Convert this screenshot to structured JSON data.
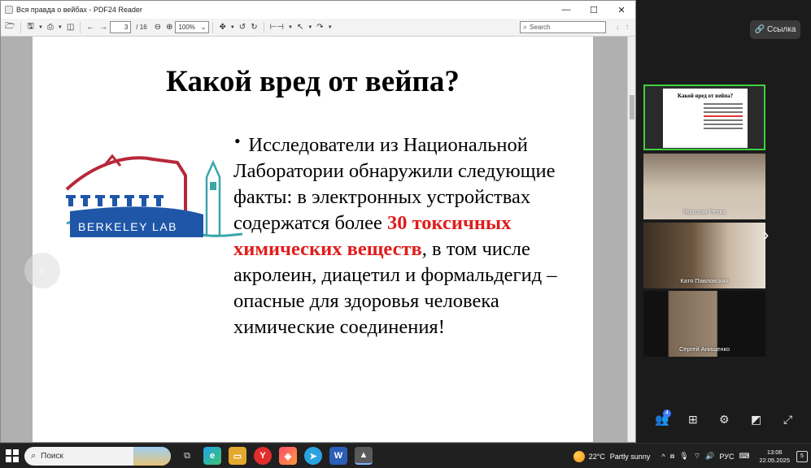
{
  "window": {
    "title": "Вся правда о вейбах - PDF24 Reader",
    "controls": {
      "minimize": "—",
      "maximize": "☐",
      "close": "✕"
    }
  },
  "toolbar": {
    "page_current": "3",
    "page_separator": "/",
    "page_total": "16",
    "zoom": "100%",
    "search_placeholder": "Search"
  },
  "slide": {
    "title": "Какой вред от вейпа?",
    "bullet": "•",
    "text_before": "Исследователи из Национальной Лаборатории обнаружили следующие факты: в электронных устройствах содержатся более ",
    "text_highlight": "30 токсичных химических веществ",
    "text_after": ", в том числе акролеин, диацетил и формальдегид – опасные для здоровья человека химические соединения!",
    "logo_text": "BERKELEY LAB",
    "colors": {
      "highlight": "#e01c1c",
      "logo_red": "#b8283a",
      "logo_blue": "#1f56a8",
      "logo_teal": "#3aa6a9"
    }
  },
  "conference": {
    "link_button": "Ссылка",
    "participants": [
      {
        "name": ""
      },
      {
        "name": "Ярослав Репка"
      },
      {
        "name": "Катя Павловская"
      },
      {
        "name": "Сергей Анищенко"
      }
    ],
    "participants_badge": "4",
    "icons": [
      "people-icon",
      "grid-icon",
      "gear-icon",
      "share-screen-icon",
      "fullscreen-icon"
    ]
  },
  "taskbar": {
    "search_label": "Поиск",
    "weather_temp": "22°C",
    "weather_text": "Partly sunny",
    "language": "РУС",
    "time": "13:06",
    "date": "22.05.2025",
    "notifications": "5"
  }
}
